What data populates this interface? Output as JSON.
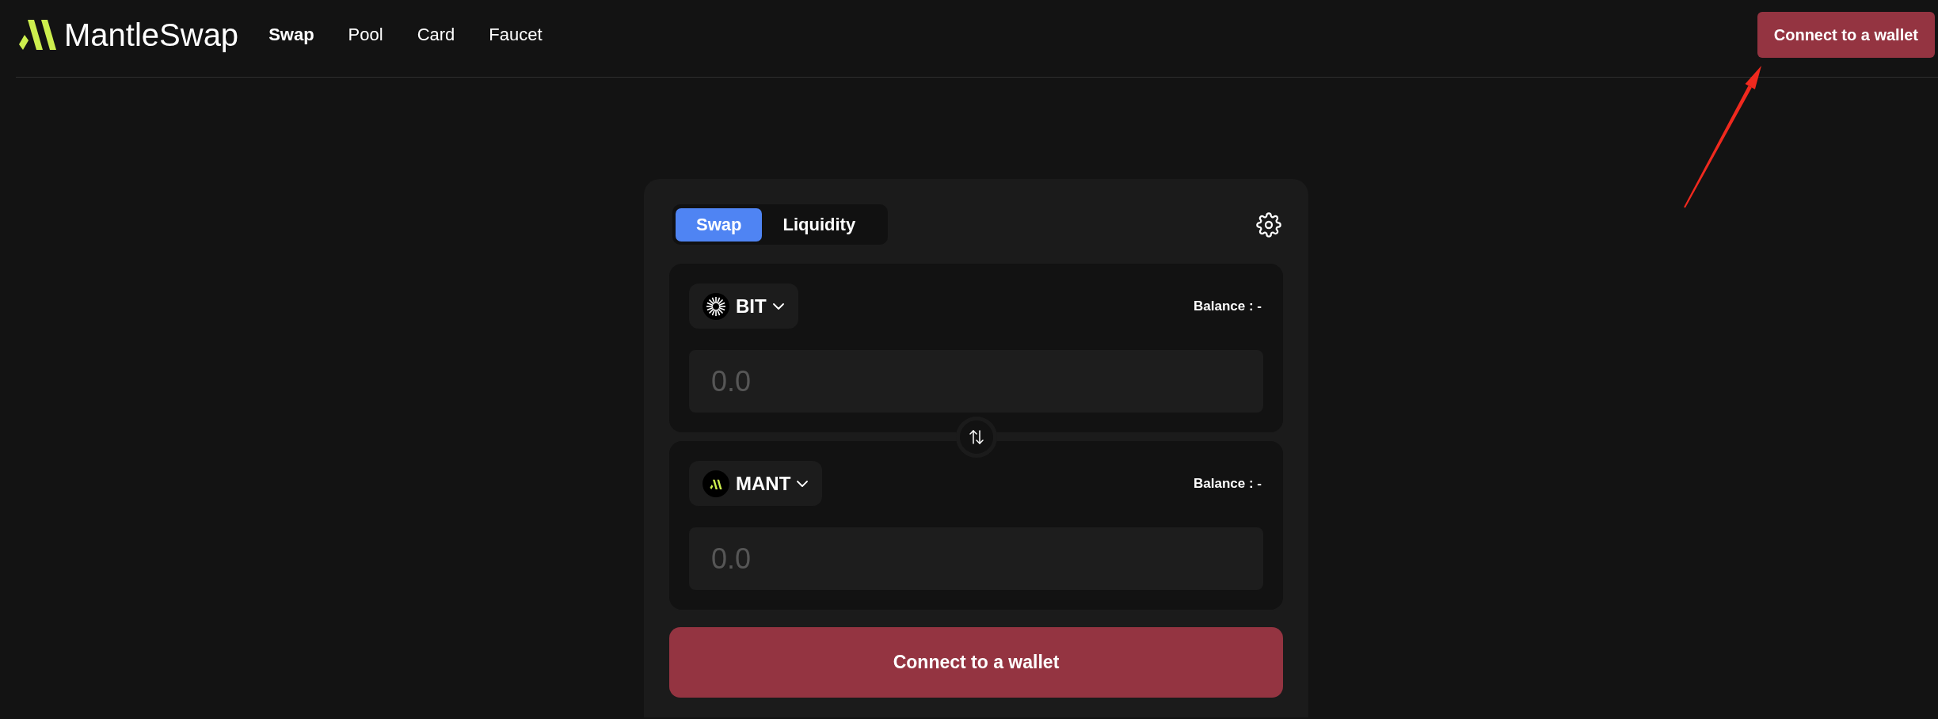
{
  "header": {
    "logo": {
      "text": "MantleSwap"
    },
    "nav": [
      {
        "label": "Swap",
        "selected": true
      },
      {
        "label": "Pool",
        "selected": false
      },
      {
        "label": "Card",
        "selected": false
      },
      {
        "label": "Faucet",
        "selected": false
      }
    ],
    "connect_button": "Connect to a wallet"
  },
  "swap_card": {
    "tabs": [
      {
        "label": "Swap",
        "selected": true
      },
      {
        "label": "Liquidity",
        "selected": false
      }
    ],
    "tokens": [
      {
        "kind": "bit",
        "symbol": "BIT",
        "balance": "Balance : -",
        "placeholder": "0.0"
      },
      {
        "kind": "mant",
        "symbol": "MANT",
        "balance": "Balance : -",
        "placeholder": "0.0"
      }
    ],
    "action_button": "Connect to a wallet"
  }
}
